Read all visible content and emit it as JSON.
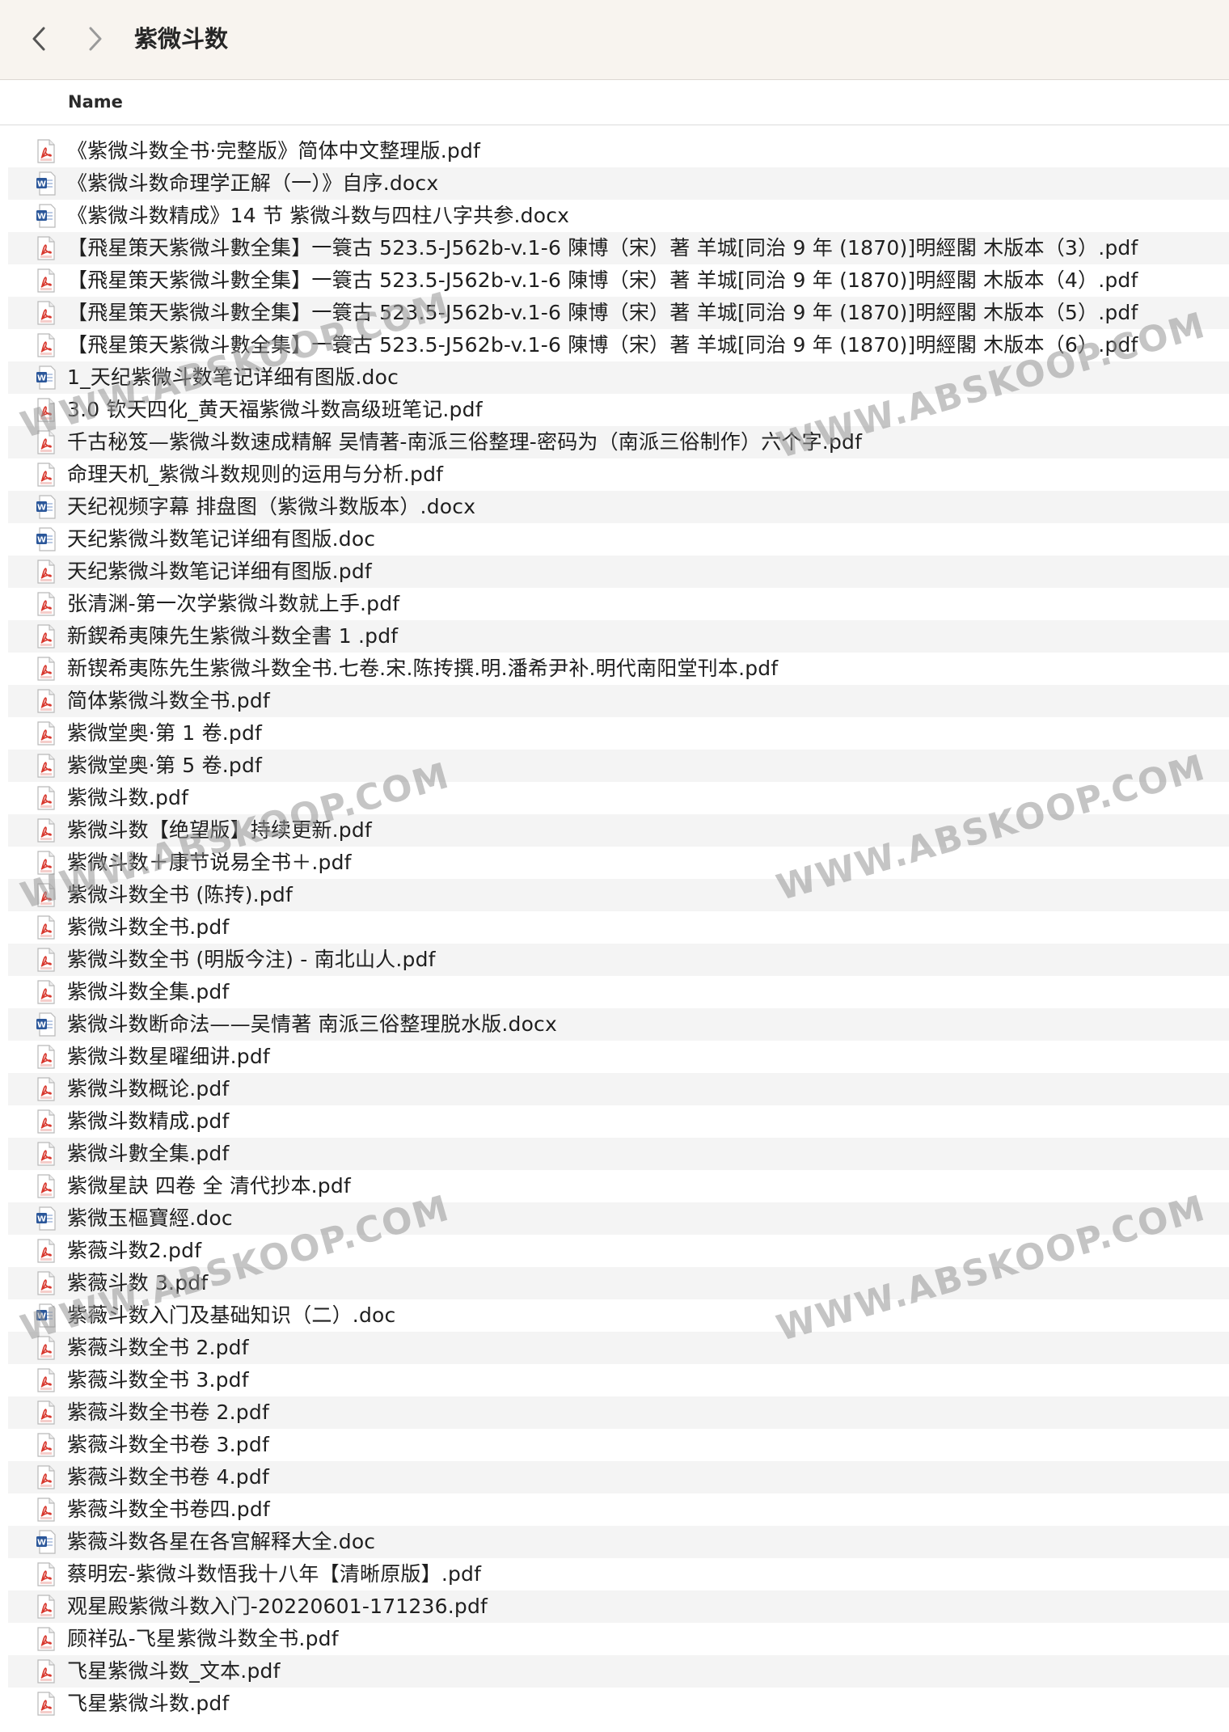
{
  "window": {
    "title": "紫微斗数",
    "back_icon": "chevron-left-icon",
    "forward_icon": "chevron-right-icon"
  },
  "header": {
    "name_column": "Name"
  },
  "colors": {
    "pdf": "#d8372d",
    "word": "#2b579a",
    "row_alt": "#f4f4f4",
    "toolbar": "#f8f4ef"
  },
  "watermark": "WWW.ABSKOOP.COM",
  "files": [
    {
      "name": "《紫微斗数全书·完整版》简体中文整理版.pdf",
      "icon": "pdf-icon"
    },
    {
      "name": "《紫微斗数命理学正解（一）》自序.docx",
      "icon": "word-icon"
    },
    {
      "name": "《紫微斗数精成》14 节 紫微斗数与四柱八字共参.docx",
      "icon": "word-icon"
    },
    {
      "name": "【飛星策天紫微斗數全集】一簑古 523.5-J562b-v.1-6 陳博（宋）著 羊城[同治 9 年 (1870)]明經閣 木版本（3）.pdf",
      "icon": "pdf-icon"
    },
    {
      "name": "【飛星策天紫微斗數全集】一簑古 523.5-J562b-v.1-6 陳博（宋）著 羊城[同治 9 年 (1870)]明經閣 木版本（4）.pdf",
      "icon": "pdf-icon"
    },
    {
      "name": "【飛星策天紫微斗數全集】一簑古 523.5-J562b-v.1-6 陳博（宋）著 羊城[同治 9 年 (1870)]明經閣 木版本（5）.pdf",
      "icon": "pdf-icon"
    },
    {
      "name": "【飛星策天紫微斗數全集】一簑古 523.5-J562b-v.1-6 陳博（宋）著 羊城[同治 9 年 (1870)]明經閣 木版本（6）.pdf",
      "icon": "pdf-icon"
    },
    {
      "name": "1_天纪紫微斗数笔记详细有图版.doc",
      "icon": "word-icon"
    },
    {
      "name": "3.0 钦天四化_黄天福紫微斗数高级班笔记.pdf",
      "icon": "pdf-icon"
    },
    {
      "name": "千古秘笈—紫微斗数速成精解 吴情著-南派三俗整理-密码为（南派三俗制作）六个字.pdf",
      "icon": "pdf-icon"
    },
    {
      "name": "命理天机_紫微斗数规则的运用与分析.pdf",
      "icon": "pdf-icon"
    },
    {
      "name": "天纪视频字幕 排盘图（紫微斗数版本）.docx",
      "icon": "word-icon"
    },
    {
      "name": "天纪紫微斗数笔记详细有图版.doc",
      "icon": "word-icon"
    },
    {
      "name": "天纪紫微斗数笔记详细有图版.pdf",
      "icon": "pdf-icon"
    },
    {
      "name": "张清渊-第一次学紫微斗数就上手.pdf",
      "icon": "pdf-icon"
    },
    {
      "name": "新鍥希夷陳先生紫微斗数全書 1 .pdf",
      "icon": "pdf-icon"
    },
    {
      "name": "新锲希夷陈先生紫微斗数全书.七卷.宋.陈抟撰.明.潘希尹补.明代南阳堂刊本.pdf",
      "icon": "pdf-icon"
    },
    {
      "name": "简体紫微斗数全书.pdf",
      "icon": "pdf-icon"
    },
    {
      "name": "紫微堂奥·第 1 卷.pdf",
      "icon": "pdf-icon"
    },
    {
      "name": "紫微堂奥·第 5 卷.pdf",
      "icon": "pdf-icon"
    },
    {
      "name": "紫微斗数.pdf",
      "icon": "pdf-icon"
    },
    {
      "name": "紫微斗数【绝望版】持续更新.pdf",
      "icon": "pdf-icon"
    },
    {
      "name": "紫微斗数＋康节说易全书＋.pdf",
      "icon": "pdf-icon"
    },
    {
      "name": "紫微斗数全书 (陈抟).pdf",
      "icon": "pdf-icon"
    },
    {
      "name": "紫微斗数全书.pdf",
      "icon": "pdf-icon"
    },
    {
      "name": "紫微斗数全书 (明版今注) - 南北山人.pdf",
      "icon": "pdf-icon"
    },
    {
      "name": "紫微斗数全集.pdf",
      "icon": "pdf-icon"
    },
    {
      "name": "紫微斗数断命法——吴情著 南派三俗整理脱水版.docx",
      "icon": "word-icon"
    },
    {
      "name": "紫微斗数星曜细讲.pdf",
      "icon": "pdf-icon"
    },
    {
      "name": "紫微斗数概论.pdf",
      "icon": "pdf-icon"
    },
    {
      "name": "紫微斗数精成.pdf",
      "icon": "pdf-icon"
    },
    {
      "name": "紫微斗數全集.pdf",
      "icon": "pdf-icon"
    },
    {
      "name": "紫微星訣 四卷 全 清代抄本.pdf",
      "icon": "pdf-icon"
    },
    {
      "name": "紫微玉樞寶經.doc",
      "icon": "word-icon"
    },
    {
      "name": "紫薇斗数2.pdf",
      "icon": "pdf-icon"
    },
    {
      "name": "紫薇斗数 3.pdf",
      "icon": "pdf-icon"
    },
    {
      "name": "紫薇斗数入门及基础知识（二）.doc",
      "icon": "word-icon"
    },
    {
      "name": "紫薇斗数全书 2.pdf",
      "icon": "pdf-icon"
    },
    {
      "name": "紫薇斗数全书 3.pdf",
      "icon": "pdf-icon"
    },
    {
      "name": "紫薇斗数全书卷 2.pdf",
      "icon": "pdf-icon"
    },
    {
      "name": "紫薇斗数全书卷 3.pdf",
      "icon": "pdf-icon"
    },
    {
      "name": "紫薇斗数全书卷 4.pdf",
      "icon": "pdf-icon"
    },
    {
      "name": "紫薇斗数全书卷四.pdf",
      "icon": "pdf-icon"
    },
    {
      "name": "紫薇斗数各星在各宫解释大全.doc",
      "icon": "word-icon"
    },
    {
      "name": "蔡明宏-紫微斗数悟我十八年【清晰原版】.pdf",
      "icon": "pdf-icon"
    },
    {
      "name": "观星殿紫微斗数入门-20220601-171236.pdf",
      "icon": "pdf-icon"
    },
    {
      "name": "顾祥弘-飞星紫微斗数全书.pdf",
      "icon": "pdf-icon"
    },
    {
      "name": "飞星紫微斗数_文本.pdf",
      "icon": "pdf-icon"
    },
    {
      "name": "飞星紫微斗数.pdf",
      "icon": "pdf-icon"
    }
  ]
}
